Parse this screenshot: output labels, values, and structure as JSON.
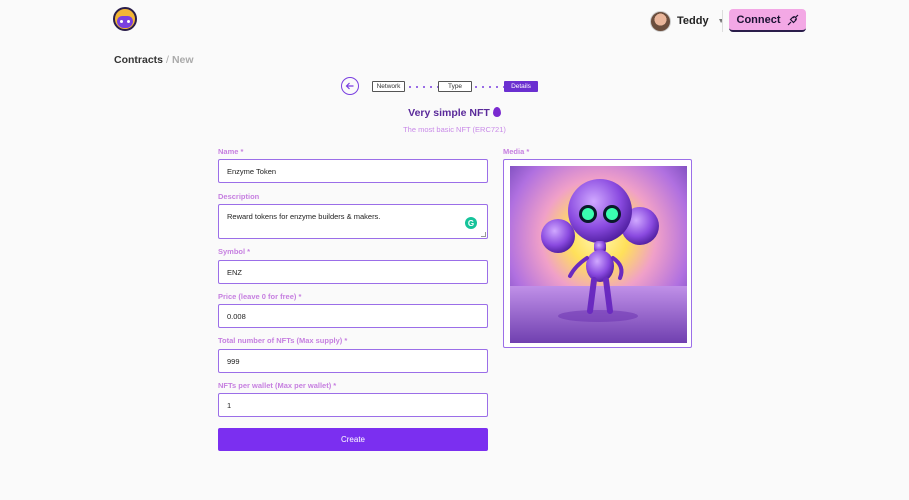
{
  "header": {
    "user_name": "Teddy",
    "connect_label": "Connect"
  },
  "breadcrumb": {
    "main": "Contracts",
    "separator": "/",
    "current": "New"
  },
  "stepper": {
    "steps": [
      {
        "label": "Network",
        "active": false
      },
      {
        "label": "Type",
        "active": false
      },
      {
        "label": "Details",
        "active": true
      }
    ]
  },
  "page": {
    "title": "Very simple NFT",
    "subtitle": "The most basic NFT (ERC721)"
  },
  "form": {
    "name_label": "Name *",
    "name_value": "Enzyme Token",
    "description_label": "Description",
    "description_value": "Reward tokens for enzyme builders & makers.",
    "symbol_label": "Symbol *",
    "symbol_value": "ENZ",
    "price_label": "Price (leave 0 for free) *",
    "price_value": "0.008",
    "supply_label": "Total number of NFTs (Max supply) *",
    "supply_value": "999",
    "per_wallet_label": "NFTs per wallet (Max per wallet) *",
    "per_wallet_value": "1",
    "create_label": "Create"
  },
  "media": {
    "label": "Media *"
  },
  "colors": {
    "accent": "#7b2ff0",
    "label": "#c67fe0",
    "connect_bg": "#f3a8e5"
  }
}
